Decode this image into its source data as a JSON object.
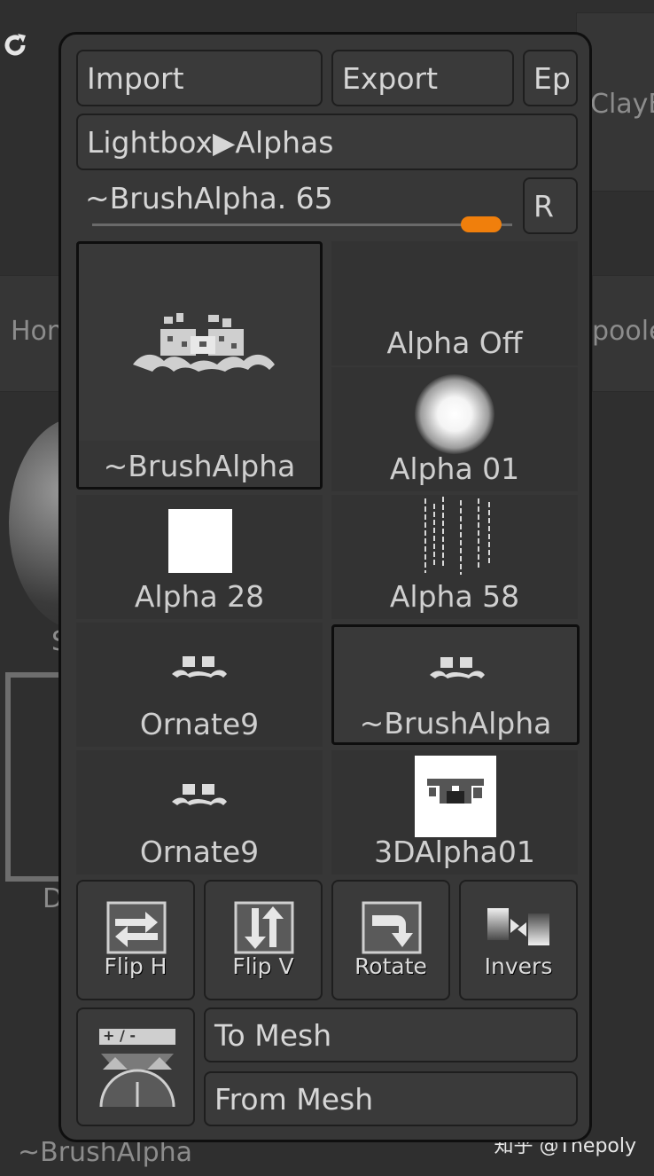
{
  "background": {
    "clay_label": "ClayB",
    "hom_label": "Hom",
    "poole_label": "poole",
    "s_label": "S",
    "d_label": "D",
    "bottom_label": "~BrushAlpha"
  },
  "popup": {
    "import_label": "Import",
    "export_label": "Export",
    "ep_label": "Ep",
    "lightbox_label": "Lightbox▶Alphas",
    "slider_label": "~BrushAlpha. 65",
    "slider_value": 65,
    "r_label": "R",
    "accent_color": "#f07f0c"
  },
  "alphas": [
    {
      "label": "~BrushAlpha",
      "thumb": "ornate-large"
    },
    {
      "label": "Alpha Off",
      "thumb": "none"
    },
    {
      "label": "Alpha 01",
      "thumb": "soft-dot"
    },
    {
      "label": "Alpha 28",
      "thumb": "white-square"
    },
    {
      "label": "Alpha 58",
      "thumb": "streaks"
    },
    {
      "label": "Ornate9",
      "thumb": "ornate-small"
    },
    {
      "label": "~BrushAlpha",
      "thumb": "ornate-small"
    },
    {
      "label": "Ornate9",
      "thumb": "ornate-small"
    },
    {
      "label": "3DAlpha01",
      "thumb": "ornate-on-white"
    }
  ],
  "tools": {
    "flip_h": "Flip H",
    "flip_v": "Flip V",
    "rotate": "Rotate",
    "invers": "Invers"
  },
  "mesh": {
    "to_mesh": "To Mesh",
    "from_mesh": "From Mesh",
    "midvalue_icon_text": "+ / -"
  },
  "watermark": "知乎 @Thepoly"
}
